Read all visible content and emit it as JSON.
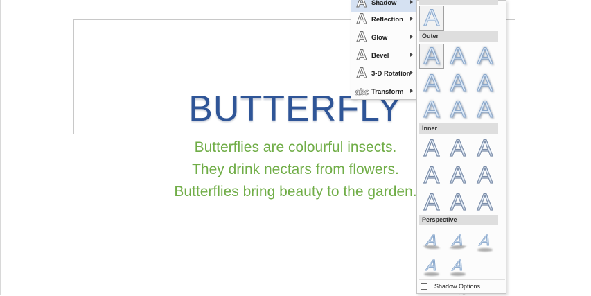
{
  "document": {
    "title": "BUTTERFLY",
    "lines": [
      "Butterflies are colourful insects.",
      "They drink nectars from flowers.",
      "Butterflies bring beauty to the garden."
    ],
    "title_color": "#2f5597",
    "body_color": "#70ad47"
  },
  "menu": {
    "items": [
      {
        "label": "Shadow",
        "icon": "letter-a-shadow-icon"
      },
      {
        "label": "Reflection",
        "icon": "letter-a-reflection-icon"
      },
      {
        "label": "Glow",
        "icon": "letter-a-glow-icon"
      },
      {
        "label": "Bevel",
        "icon": "letter-a-bevel-icon"
      },
      {
        "label": "3-D Rotation",
        "icon": "letter-a-3d-rotation-icon"
      },
      {
        "label": "Transform",
        "icon": "abc-transform-icon"
      }
    ],
    "icon_glyph": "A",
    "transform_glyph": "abc"
  },
  "gallery": {
    "sections": {
      "outer": "Outer",
      "inner": "Inner",
      "perspective": "Perspective"
    },
    "glyph": "A",
    "options_label": "Shadow Options...",
    "grip": "....",
    "accent": "#d5e1f2"
  }
}
